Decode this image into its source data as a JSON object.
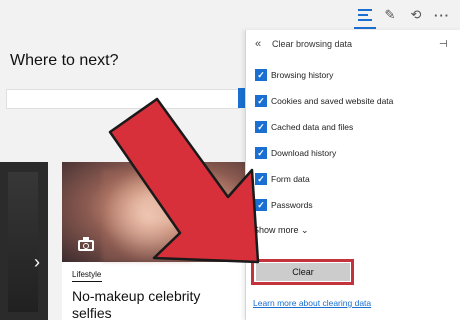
{
  "toolbar": {
    "icons": [
      "hub-icon",
      "web-note-icon",
      "share-icon",
      "more-icon"
    ],
    "more_glyph": "···",
    "active_accent": "#1a6fd0"
  },
  "page": {
    "heading": "Where to next?",
    "card": {
      "category": "Lifestyle",
      "title": "No-makeup celebrity selfies"
    }
  },
  "panel": {
    "back_glyph": "«",
    "title": "Clear browsing data",
    "pin_glyph": "⊣",
    "options": [
      {
        "label": "Browsing history",
        "checked": true
      },
      {
        "label": "Cookies and saved website data",
        "checked": true
      },
      {
        "label": "Cached data and files",
        "checked": true
      },
      {
        "label": "Download history",
        "checked": true
      },
      {
        "label": "Form data",
        "checked": true
      },
      {
        "label": "Passwords",
        "checked": true
      }
    ],
    "show_more": "Show more ⌄",
    "clear_label": "Clear",
    "learn_more": "Learn more about clearing data"
  },
  "colors": {
    "accent": "#1a6fd0",
    "highlight_arrow": "#d7303a",
    "highlight_outline": "#c4323b"
  }
}
